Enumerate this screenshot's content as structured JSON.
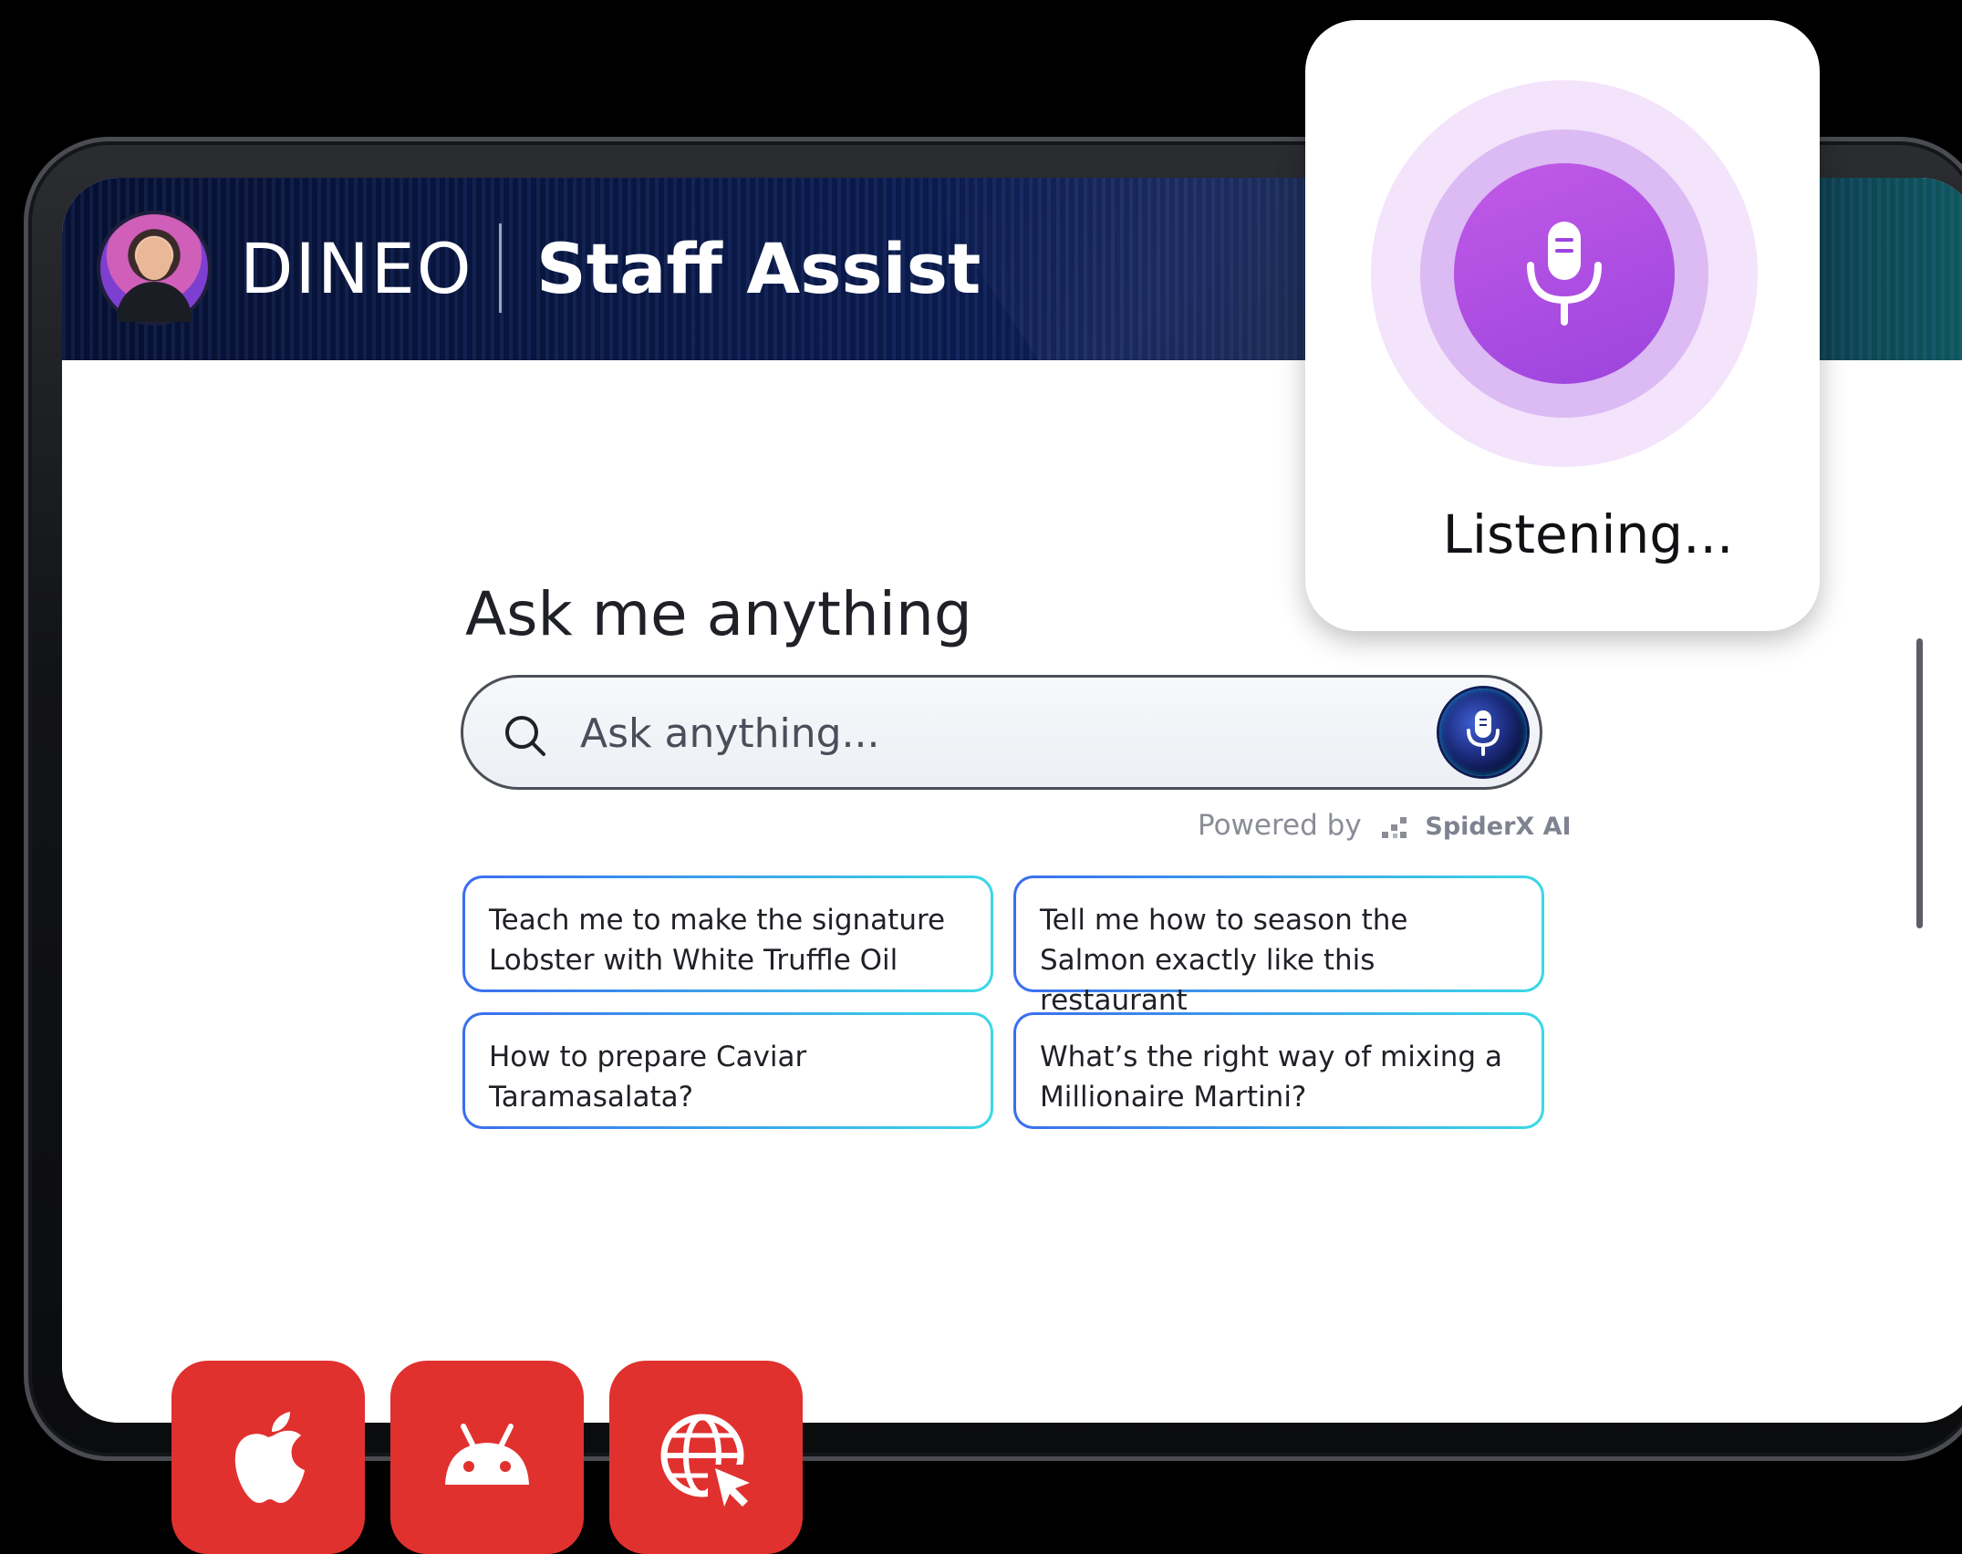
{
  "header": {
    "brand": "DINEO",
    "product": "Staff Assist"
  },
  "main": {
    "title": "Ask me anything",
    "search": {
      "placeholder": "Ask anything..."
    },
    "powered_by": {
      "label": "Powered by",
      "company": "SpiderX AI"
    },
    "suggestions": [
      {
        "text": "Teach me to make the signature Lobster with White Truffle Oil"
      },
      {
        "text": "Tell me how to season the Salmon exactly like this restaurant"
      },
      {
        "text": "How to prepare Caviar Taramasalata?"
      },
      {
        "text": "What’s the right way of mixing a Millionaire Martini?"
      }
    ]
  },
  "voice_popup": {
    "status": "Listening..."
  },
  "platforms": [
    {
      "icon": "apple-icon"
    },
    {
      "icon": "android-icon"
    },
    {
      "icon": "web-icon"
    }
  ],
  "colors": {
    "accent_purple": "#9b44de",
    "badge_red": "#e0312f",
    "header_navy": "#0a1a4a"
  }
}
